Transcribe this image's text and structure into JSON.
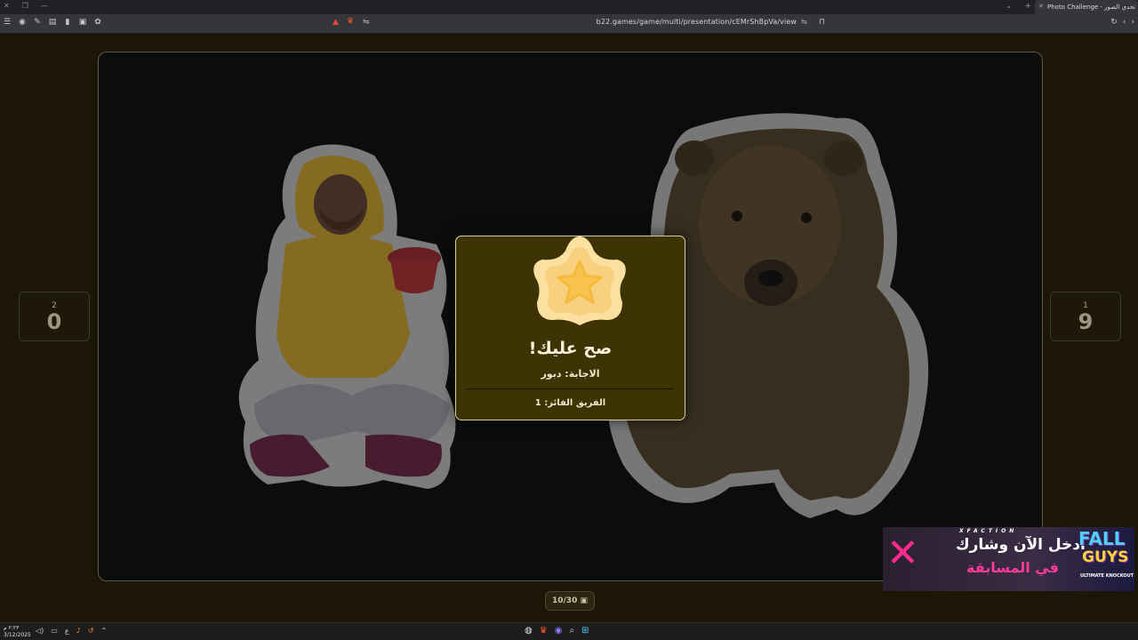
{
  "browser": {
    "tab_title": "Photo Challenge - تحدي الصور",
    "url": "b22.games/game/multi/presentation/cEMrShBpVa/view"
  },
  "scores": {
    "left": {
      "team": "2",
      "score": "0"
    },
    "right": {
      "team": "1",
      "score": "9"
    }
  },
  "result": {
    "title": "صح عليك!",
    "answer": "الاجابة: دبور",
    "winner": "الفريق الفائز: 1"
  },
  "counter": "10/30",
  "ad": {
    "brand": "XFACTION",
    "line1": "ادخل الآن وشارك",
    "line2": "في المسابقة",
    "logo_top": "FALL",
    "logo_bottom": "GUYS",
    "logo_tag": "ULTIMATE KNOCKOUT"
  },
  "taskbar": {
    "time": "٢:٢٣ م",
    "date": "3/12/2025",
    "lang": "ع"
  },
  "colors": {
    "modal_bg": "#3d3304",
    "stage_bg": "#0b0c0b",
    "star": "#f7c95a",
    "ad_pink": "#ff2a8c"
  }
}
